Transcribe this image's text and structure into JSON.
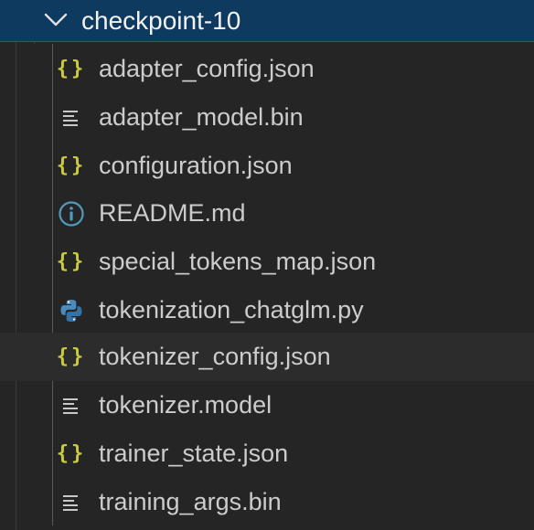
{
  "folder": {
    "name": "checkpoint-10",
    "expanded": true
  },
  "files": [
    {
      "name": "adapter_config.json",
      "icon": "json-braces-icon",
      "icon_text": "{}"
    },
    {
      "name": "adapter_model.bin",
      "icon": "text-lines-icon"
    },
    {
      "name": "configuration.json",
      "icon": "json-braces-icon",
      "icon_text": "{}"
    },
    {
      "name": "README.md",
      "icon": "info-circle-icon"
    },
    {
      "name": "special_tokens_map.json",
      "icon": "json-braces-icon",
      "icon_text": "{}"
    },
    {
      "name": "tokenization_chatglm.py",
      "icon": "python-icon"
    },
    {
      "name": "tokenizer_config.json",
      "icon": "json-braces-icon",
      "icon_text": "{}",
      "hovered": true
    },
    {
      "name": "tokenizer.model",
      "icon": "text-lines-icon"
    },
    {
      "name": "trainer_state.json",
      "icon": "json-braces-icon",
      "icon_text": "{}"
    },
    {
      "name": "training_args.bin",
      "icon": "text-lines-icon"
    }
  ],
  "colors": {
    "background": "#252526",
    "selected_folder_bg": "#0f3a5f",
    "json_icon": "#cbcb41",
    "info_icon": "#519aba",
    "python_blue": "#3572a5",
    "python_yellow": "#ffd43b",
    "text": "#cccccc"
  }
}
